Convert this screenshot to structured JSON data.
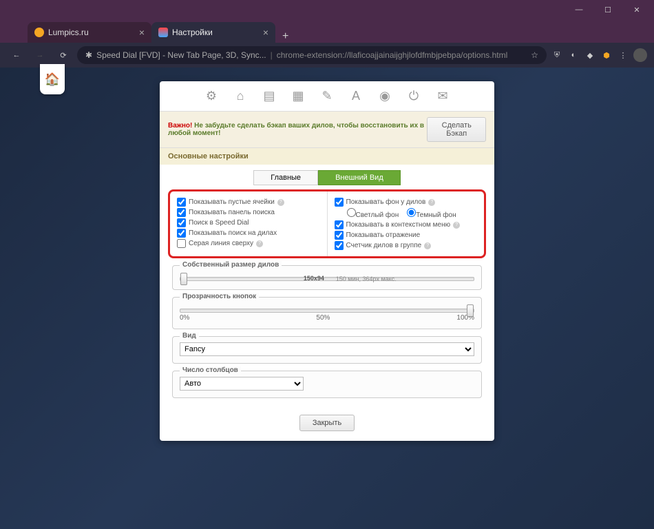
{
  "window": {
    "min": "—",
    "max": "☐",
    "close": "✕"
  },
  "tabs": {
    "t1": {
      "title": "Lumpics.ru"
    },
    "t2": {
      "title": "Настройки"
    }
  },
  "nav": {
    "back": "←",
    "fwd": "→",
    "reload": "⟳",
    "lock": "✱"
  },
  "url": {
    "prefix": "Speed Dial [FVD] - New Tab Page, 3D, Sync...",
    "path": "chrome-extension://llaficoajjainaijghjlofdfmbjpebpa/options.html",
    "star": "☆"
  },
  "warning": {
    "label": "Важно!",
    "text": "Не забудьте сделать бэкап ваших дилов, чтобы восстановить их в любой момент!",
    "backup": "Сделать Бэкап"
  },
  "section": "Основные настройки",
  "subtabs": {
    "main": "Главные",
    "appearance": "Внешний Вид"
  },
  "opts": {
    "left": {
      "empty_cells": "Показывать пустые ячейки",
      "search_panel": "Показывать панель поиска",
      "sd_search": "Поиск в Speed Dial",
      "search_on_dials": "Показывать поиск на дилах",
      "gray_line": "Серая линия сверху"
    },
    "right": {
      "bg": "Показывать фон у дилов",
      "light": "Светлый фон",
      "dark": "Темный фон",
      "context": "Показывать в контекстном меню",
      "reflection": "Показывать отражение",
      "counter": "Счетчик дилов в группе"
    }
  },
  "sliders": {
    "size": {
      "label": "Собственный размер дилов",
      "value": "150x94",
      "hint": "150 мин, 364px макс."
    },
    "opacity": {
      "label": "Прозрачность кнопок",
      "m0": "0%",
      "m50": "50%",
      "m100": "100%"
    }
  },
  "view": {
    "label": "Вид",
    "value": "Fancy"
  },
  "cols": {
    "label": "Число столбцов",
    "value": "Авто"
  },
  "close": "Закрыть"
}
